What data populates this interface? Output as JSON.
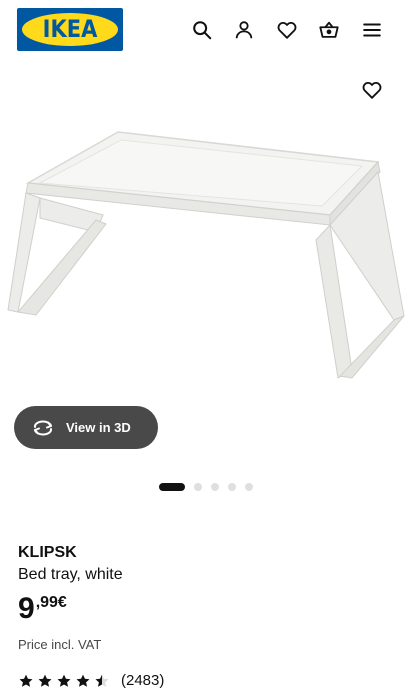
{
  "header": {
    "logo_text": "IKEA",
    "icons": [
      "search-icon",
      "user-icon",
      "heart-icon",
      "basket-icon",
      "menu-icon"
    ]
  },
  "gallery": {
    "view_3d_label": "View in 3D",
    "slide_count": 5,
    "active_slide": 1
  },
  "product": {
    "name": "KLIPSK",
    "description": "Bed tray, white",
    "price_integer": "9",
    "price_decimal": ",99€",
    "vat_note": "Price incl. VAT",
    "rating_value": 4.5,
    "rating_count": "(2483)"
  },
  "colors": {
    "ikea_blue": "#0058a3",
    "ikea_yellow": "#ffda1a",
    "button_dark": "#494949"
  }
}
